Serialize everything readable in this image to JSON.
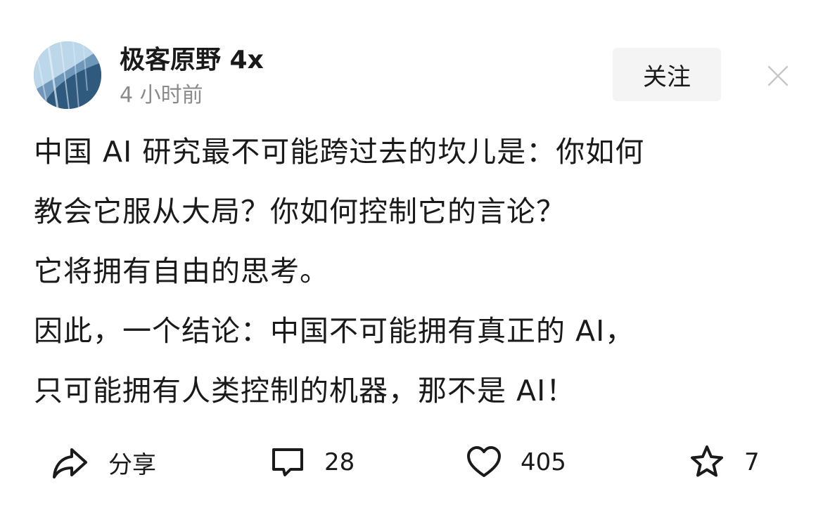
{
  "author": {
    "name": "极客原野 4x",
    "time": "4 小时前"
  },
  "follow_label": "关注",
  "post": {
    "lines": [
      "中国 AI 研究最不可能跨过去的坎儿是：你如何",
      "教会它服从大局？你如何控制它的言论？",
      "它将拥有自由的思考。",
      "因此，一个结论：中国不可能拥有真正的 AI，",
      "只可能拥有人类控制的机器，那不是 AI！"
    ]
  },
  "actions": {
    "share": {
      "label": "分享",
      "icon": "share-icon"
    },
    "comment": {
      "count": "28",
      "icon": "comment-icon"
    },
    "like": {
      "count": "405",
      "icon": "heart-icon"
    },
    "favorite": {
      "count": "7",
      "icon": "star-icon"
    }
  },
  "colors": {
    "text": "#1a1a1a",
    "muted": "#8a8a8a",
    "follow_bg": "#f4f4f4"
  }
}
